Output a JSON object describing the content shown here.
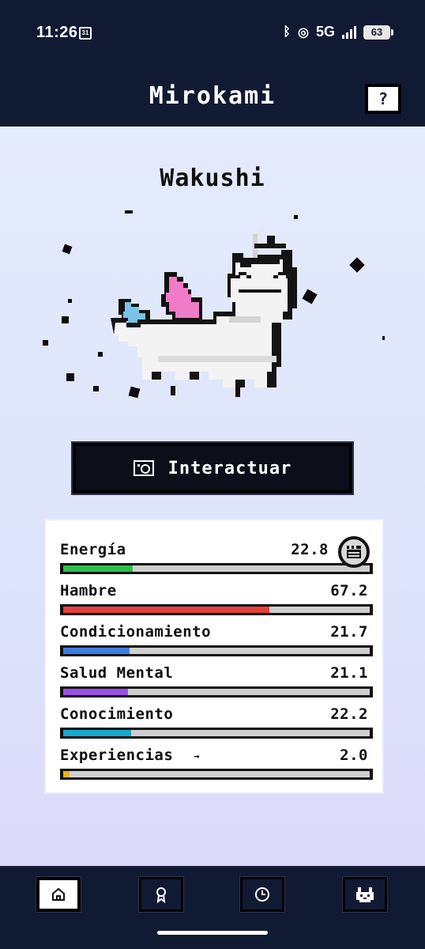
{
  "status_bar": {
    "time": "11:26",
    "calendar_day": "31",
    "network": "5G",
    "battery": "63"
  },
  "app_bar": {
    "title": "Mirokami",
    "help_label": "?"
  },
  "pet": {
    "name": "Wakushi"
  },
  "interact_button": {
    "label": "Interactuar"
  },
  "stats": [
    {
      "label": "Energía",
      "value": "22.8",
      "fill": 0.228,
      "color": "#2fbf4f",
      "has_ad_icon": true
    },
    {
      "label": "Hambre",
      "value": "67.2",
      "fill": 0.672,
      "color": "#e5403b"
    },
    {
      "label": "Condicionamiento",
      "value": "21.7",
      "fill": 0.217,
      "color": "#3f7de0"
    },
    {
      "label": "Salud Mental",
      "value": "21.1",
      "fill": 0.211,
      "color": "#9a4fe6"
    },
    {
      "label": "Conocimiento",
      "value": "22.2",
      "fill": 0.222,
      "color": "#16a9cf"
    },
    {
      "label": "Experiencias",
      "value": "2.0",
      "fill": 0.02,
      "color": "#e8b21a",
      "arrow": "→"
    }
  ],
  "nav": {
    "items": [
      {
        "icon": "home-icon",
        "active": true
      },
      {
        "icon": "award-icon",
        "active": false
      },
      {
        "icon": "clock-icon",
        "active": false
      },
      {
        "icon": "mirokami-logo-icon",
        "active": false
      }
    ]
  },
  "colors": {
    "dark": "#111a33",
    "background": "#dfe6fb"
  }
}
